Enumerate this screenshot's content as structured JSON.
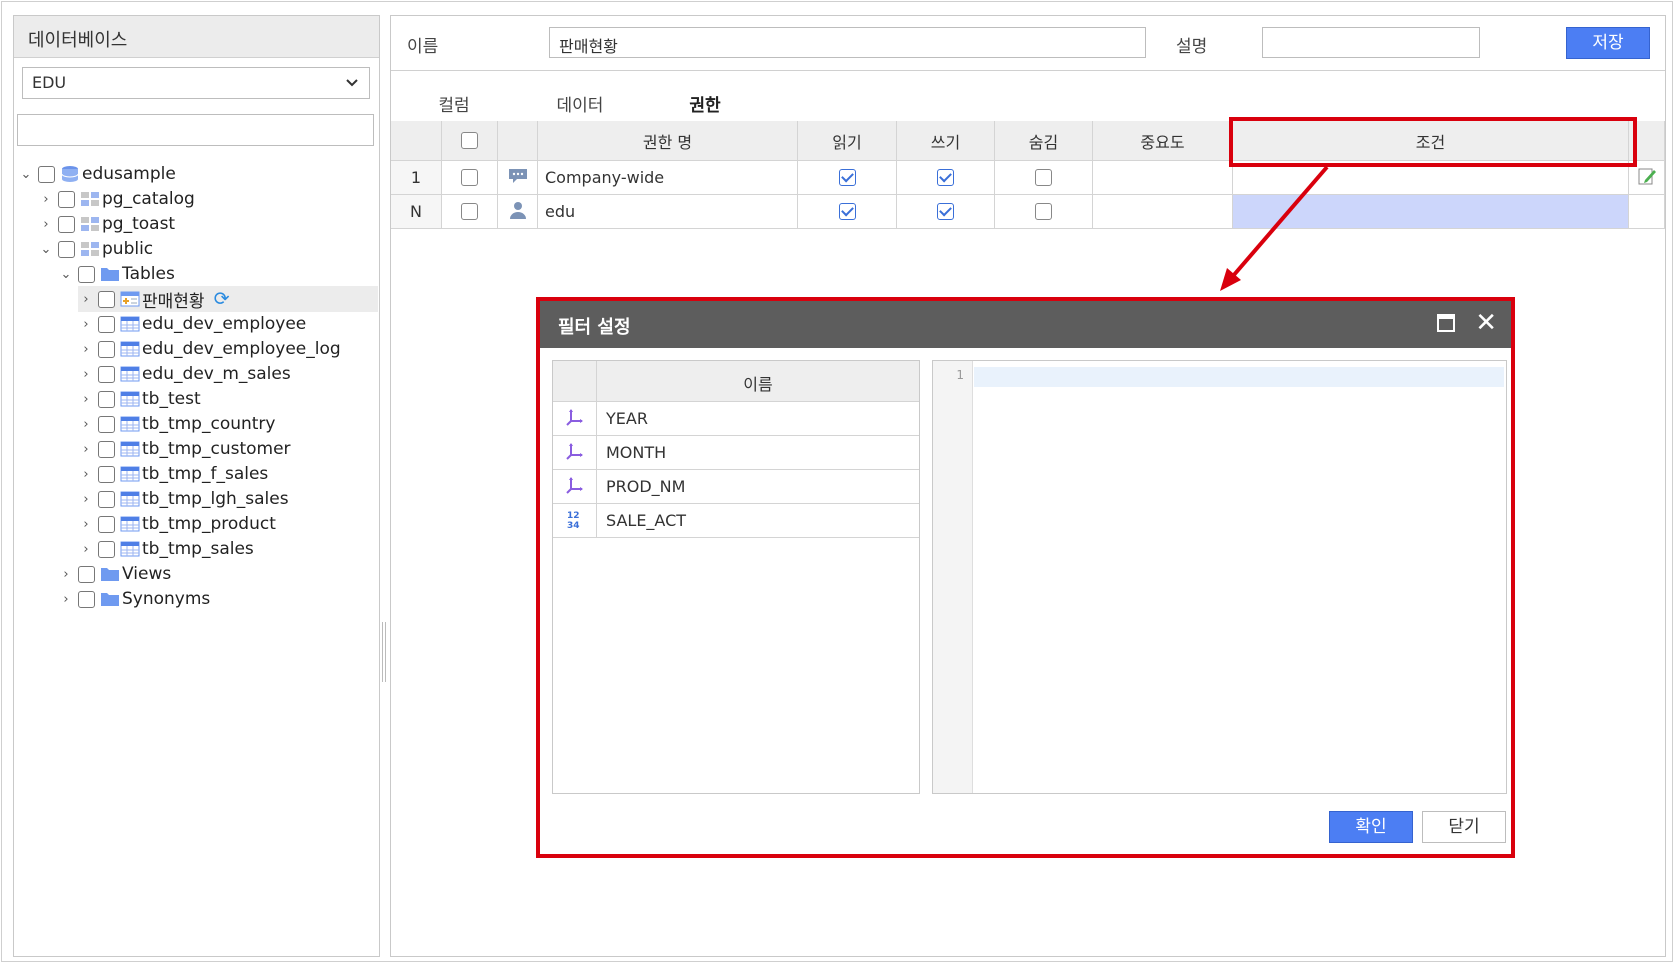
{
  "left_panel": {
    "title": "데이터베이스",
    "db_select": {
      "value": "EDU"
    },
    "search": {
      "value": ""
    },
    "tree": [
      {
        "label": "edusample",
        "icon": "database-icon",
        "expanded": true
      },
      {
        "label": "pg_catalog",
        "icon": "schema-icon",
        "expanded": false
      },
      {
        "label": "pg_toast",
        "icon": "schema-icon",
        "expanded": false
      },
      {
        "label": "public",
        "icon": "schema-icon",
        "expanded": true
      },
      {
        "label": "Tables",
        "icon": "folder-icon",
        "expanded": true
      },
      {
        "label": "판매현황",
        "icon": "view-table-icon",
        "selected": true
      },
      {
        "label": "edu_dev_employee",
        "icon": "table-icon"
      },
      {
        "label": "edu_dev_employee_log",
        "icon": "table-icon"
      },
      {
        "label": "edu_dev_m_sales",
        "icon": "table-icon"
      },
      {
        "label": "tb_test",
        "icon": "table-icon"
      },
      {
        "label": "tb_tmp_country",
        "icon": "table-icon"
      },
      {
        "label": "tb_tmp_customer",
        "icon": "table-icon"
      },
      {
        "label": "tb_tmp_f_sales",
        "icon": "table-icon"
      },
      {
        "label": "tb_tmp_lgh_sales",
        "icon": "table-icon"
      },
      {
        "label": "tb_tmp_product",
        "icon": "table-icon"
      },
      {
        "label": "tb_tmp_sales",
        "icon": "table-icon"
      },
      {
        "label": "Views",
        "icon": "folder-icon",
        "expanded": false
      },
      {
        "label": "Synonyms",
        "icon": "folder-icon",
        "expanded": false
      }
    ]
  },
  "form": {
    "name_label": "이름",
    "name_value": "판매현황",
    "desc_label": "설명",
    "desc_value": "",
    "save_label": "저장"
  },
  "tabs": [
    {
      "label": "컬럼",
      "active": false
    },
    {
      "label": "데이터",
      "active": false
    },
    {
      "label": "권한",
      "active": true
    }
  ],
  "permission_grid": {
    "headers": [
      "권한 명",
      "읽기",
      "쓰기",
      "숨김",
      "중요도",
      "조건"
    ],
    "rows": [
      {
        "num": "1",
        "icon": "chat-icon",
        "name": "Company-wide",
        "read": true,
        "write": true,
        "hidden": false,
        "importance": "",
        "condition": ""
      },
      {
        "num": "N",
        "icon": "user-icon",
        "name": "edu",
        "read": true,
        "write": true,
        "hidden": false,
        "importance": "",
        "condition": ""
      }
    ]
  },
  "dialog": {
    "title": "필터 설정",
    "column_header": "이름",
    "columns": [
      {
        "name": "YEAR",
        "icon": "dimension-icon"
      },
      {
        "name": "MONTH",
        "icon": "dimension-icon"
      },
      {
        "name": "PROD_NM",
        "icon": "dimension-icon"
      },
      {
        "name": "SALE_ACT",
        "icon": "numeric-icon"
      }
    ],
    "editor_line_number": "1",
    "ok_label": "확인",
    "close_label": "닫기"
  },
  "colors": {
    "accent": "#4c7ef3",
    "annotation_red": "#d9000d",
    "dialog_title_bg": "#5d5d5d",
    "condition_highlight": "#ccd6fb"
  }
}
